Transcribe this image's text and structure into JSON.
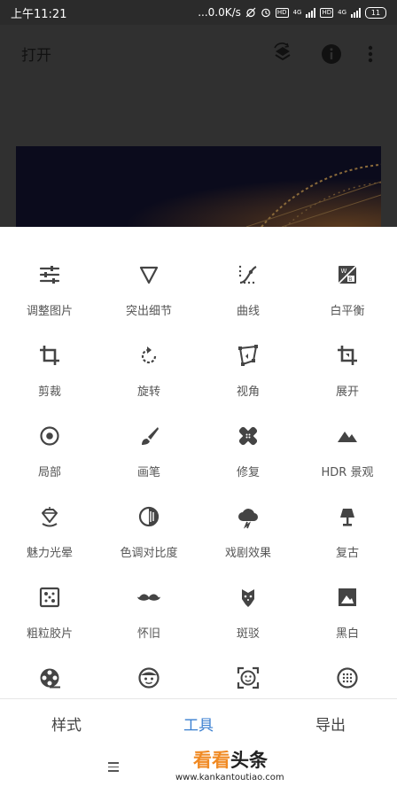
{
  "status": {
    "time": "上午11:21",
    "net": "...0.0K/s",
    "hd1": "HD",
    "g1": "4G",
    "hd2": "HD",
    "g2": "4G",
    "battery": "11"
  },
  "appbar": {
    "title": "打开"
  },
  "tools": [
    {
      "label": "调整图片",
      "icon": "tune-sliders-icon"
    },
    {
      "label": "突出细节",
      "icon": "triangle-down-icon"
    },
    {
      "label": "曲线",
      "icon": "curves-icon"
    },
    {
      "label": "白平衡",
      "icon": "white-balance-icon"
    },
    {
      "label": "剪裁",
      "icon": "crop-icon"
    },
    {
      "label": "旋转",
      "icon": "rotate-icon"
    },
    {
      "label": "视角",
      "icon": "perspective-icon"
    },
    {
      "label": "展开",
      "icon": "expand-icon"
    },
    {
      "label": "局部",
      "icon": "selective-icon"
    },
    {
      "label": "画笔",
      "icon": "brush-icon"
    },
    {
      "label": "修复",
      "icon": "healing-icon"
    },
    {
      "label": "HDR 景观",
      "icon": "mountain-icon"
    },
    {
      "label": "魅力光晕",
      "icon": "glamour-glow-icon"
    },
    {
      "label": "色调对比度",
      "icon": "tonal-contrast-icon"
    },
    {
      "label": "戏剧效果",
      "icon": "drama-cloud-icon"
    },
    {
      "label": "复古",
      "icon": "vintage-lamp-icon"
    },
    {
      "label": "粗粒胶片",
      "icon": "grainy-film-icon"
    },
    {
      "label": "怀旧",
      "icon": "mustache-icon"
    },
    {
      "label": "斑驳",
      "icon": "grunge-icon"
    },
    {
      "label": "黑白",
      "icon": "black-white-icon"
    },
    {
      "label": "",
      "icon": "film-reel-icon"
    },
    {
      "label": "",
      "icon": "face-icon"
    },
    {
      "label": "",
      "icon": "face-detect-icon"
    },
    {
      "label": "",
      "icon": "dots-circle-icon"
    }
  ],
  "tabs": [
    {
      "label": "样式",
      "active": false
    },
    {
      "label": "工具",
      "active": true
    },
    {
      "label": "导出",
      "active": false
    }
  ],
  "watermark": {
    "logo_a": "看看",
    "logo_b": "头条",
    "url": "www.kankantoutiao.com"
  },
  "colors": {
    "accent": "#3a7fd0",
    "dim_overlay": "#303030",
    "icon": "#444444"
  }
}
